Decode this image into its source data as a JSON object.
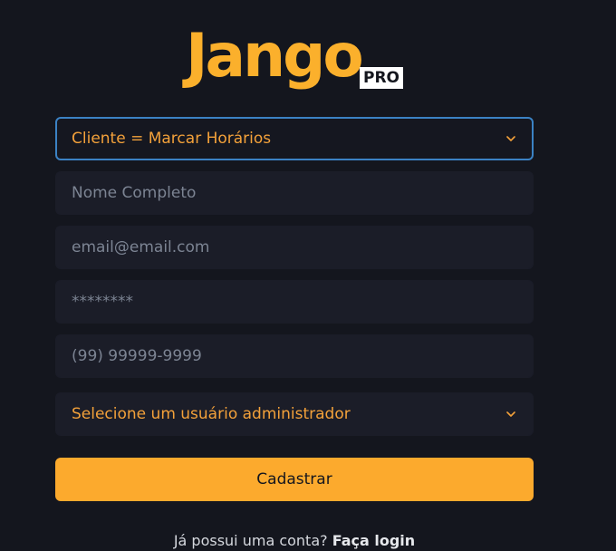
{
  "logo": {
    "word": "Jango",
    "badge": "PRO"
  },
  "form": {
    "user_type_select": {
      "selected": "Cliente = Marcar Horários"
    },
    "full_name": {
      "placeholder": "Nome Completo"
    },
    "email": {
      "placeholder": "email@email.com"
    },
    "password": {
      "placeholder": "********"
    },
    "phone": {
      "placeholder": "(99) 99999-9999"
    },
    "admin_select": {
      "selected": "Selecione um usuário administrador"
    },
    "submit_label": "Cadastrar"
  },
  "footer": {
    "prompt": "Já possui uma conta?",
    "login_link": "Faça login"
  },
  "colors": {
    "background": "#14161e",
    "brand": "#fbb02c",
    "field_bg": "#1b1d28",
    "focus_border": "#3b82c4",
    "select_text": "#f3a13a",
    "placeholder": "#7c8493"
  },
  "icons": [
    "chevron-down-icon"
  ]
}
